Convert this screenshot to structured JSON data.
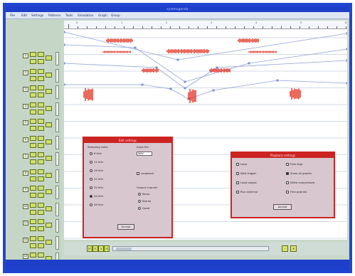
{
  "window": {
    "title": "xylemagenda"
  },
  "menu": [
    "File",
    "Edit",
    "Settings",
    "Patterns",
    "Tools",
    "Simulation",
    "Graph",
    "Group"
  ],
  "tracks": [
    {
      "num": "1"
    },
    {
      "num": "2"
    },
    {
      "num": "3"
    },
    {
      "num": "4"
    },
    {
      "num": "5"
    },
    {
      "num": "6"
    },
    {
      "num": "7"
    },
    {
      "num": "8"
    },
    {
      "num": "9"
    },
    {
      "num": "10"
    },
    {
      "num": "11"
    },
    {
      "num": "12"
    },
    {
      "num": "13"
    }
  ],
  "ruler": {
    "labels": [
      "0",
      "1",
      "2",
      "3",
      "4",
      "5",
      "6"
    ]
  },
  "dialog_left": {
    "title": "Edit settings",
    "section_sampling": "Sampling rates",
    "rates": [
      "8 kHz",
      "11 kHz",
      "16 kHz",
      "22 kHz",
      "32 kHz",
      "44 kHz",
      "48 kHz"
    ],
    "selected_rate": "44 kHz",
    "input_label": "Input file",
    "input_value": "WAV",
    "option_label": "Loopback",
    "output_label": "Output channel",
    "outputs": [
      "Mono",
      "Stereo",
      "Quad"
    ],
    "button": "Accept"
  },
  "dialog_right": {
    "title": "Playback settings",
    "options_left": [
      "Loop",
      "Wait trigger",
      "Load output",
      "Run external"
    ],
    "options_right": [
      "Free stop",
      "Show all graphs",
      "Write compressed",
      "Fine grained"
    ],
    "checked": [
      "Show all graphs"
    ],
    "button": "Accept"
  },
  "transport": {
    "buttons": [
      "|<",
      "<",
      ">",
      ">|"
    ],
    "zoom": [
      "–",
      "+"
    ]
  },
  "colors": {
    "frame": "#1f46d3",
    "dialog_border": "#cc2422",
    "waveform": "#e02a1a",
    "envelope": "#8f9fd8"
  }
}
